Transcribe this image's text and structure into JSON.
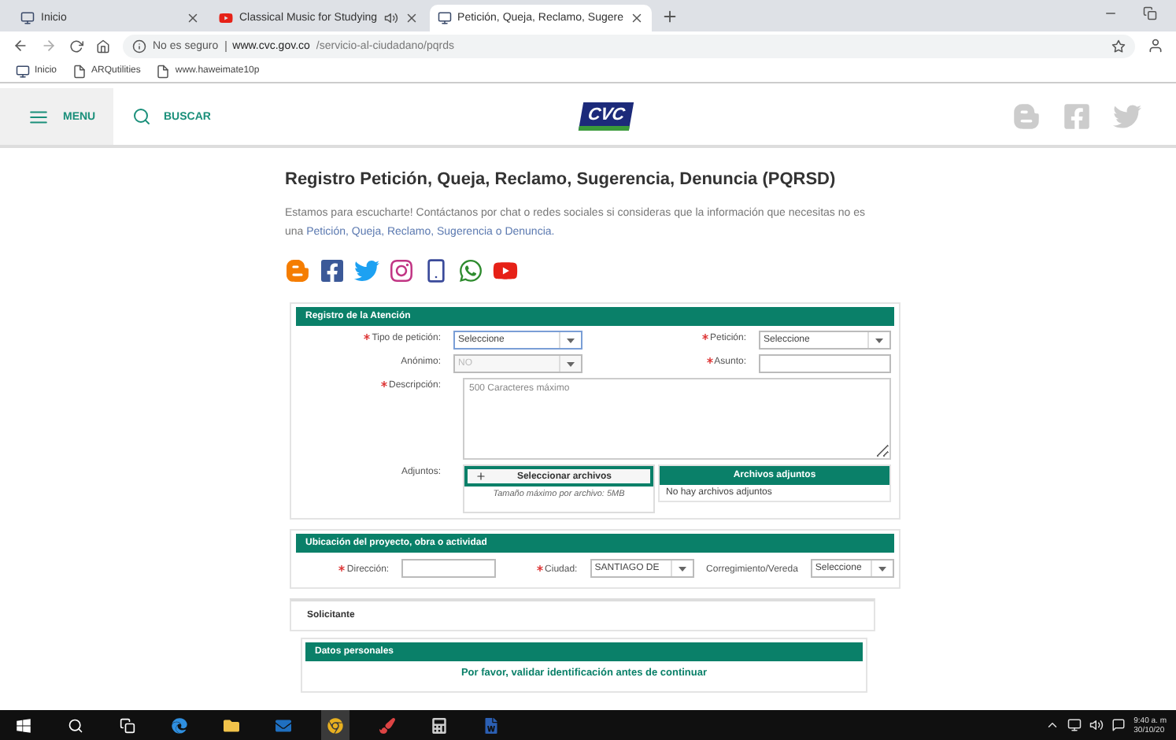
{
  "browser": {
    "tabs": [
      {
        "title": "Inicio",
        "audio": false,
        "selected": false
      },
      {
        "title": "Classical Music for Studying",
        "audio": true,
        "selected": false
      },
      {
        "title": "Petición, Queja, Reclamo, Sugere",
        "audio": false,
        "selected": true
      }
    ],
    "security": "No es seguro",
    "url_host": "www.cvc.gov.co",
    "url_path": "/servicio-al-ciudadano/pqrds",
    "bookmarks": [
      "Inicio",
      "ARQutilities",
      "www.haweimate10p"
    ]
  },
  "header": {
    "menu": "MENU",
    "search": "BUSCAR",
    "logo": "CVC"
  },
  "page": {
    "title": "Registro Petición, Queja, Reclamo, Sugerencia, Denuncia (PQRSD)",
    "intro": "Estamos para escucharte! Contáctanos por chat o redes sociales si consideras que la información que necesitas no es una ",
    "intro_link": "Petición, Queja, Reclamo, Sugerencia o Denuncia."
  },
  "registro": {
    "title": "Registro de la Atención",
    "fields": [
      {
        "label": "Tipo de petición:",
        "required": true,
        "kind": "select",
        "value": "Seleccione",
        "disabled": false,
        "focused": true
      },
      {
        "label": "Petición:",
        "required": true,
        "kind": "select",
        "value": "Seleccione",
        "disabled": false,
        "focused": false
      },
      {
        "label": "Anónimo:",
        "required": false,
        "kind": "select",
        "value": "NO",
        "disabled": true,
        "focused": false
      },
      {
        "label": "Asunto:",
        "required": true,
        "kind": "input",
        "disabled": false,
        "focused": false
      }
    ],
    "description": {
      "label": "Descripción:",
      "required": true,
      "placeholder": "500 Caracteres máximo"
    },
    "attachments": {
      "label": "Adjuntos:",
      "button": "Seleccionar archivos",
      "note": "Tamaño máximo por archivo: 5MB",
      "panel_title": "Archivos adjuntos",
      "empty": "No hay archivos adjuntos"
    }
  },
  "ubicacion": {
    "title": "Ubicación del proyecto, obra o actividad",
    "fields": [
      {
        "label": "Dirección:",
        "required": true,
        "kind": "input"
      },
      {
        "label": "Ciudad:",
        "required": true,
        "kind": "select",
        "value": "SANTIAGO DE"
      },
      {
        "label": "Corregimiento/Vereda",
        "required": false,
        "kind": "select",
        "value": "Seleccione"
      }
    ]
  },
  "solicitante": {
    "title": "Solicitante",
    "subsection": "Datos personales",
    "message": "Por favor, validar identificación antes de continuar"
  },
  "taskbar": {
    "time": "9:40 a. m",
    "date": "30/10/20"
  }
}
